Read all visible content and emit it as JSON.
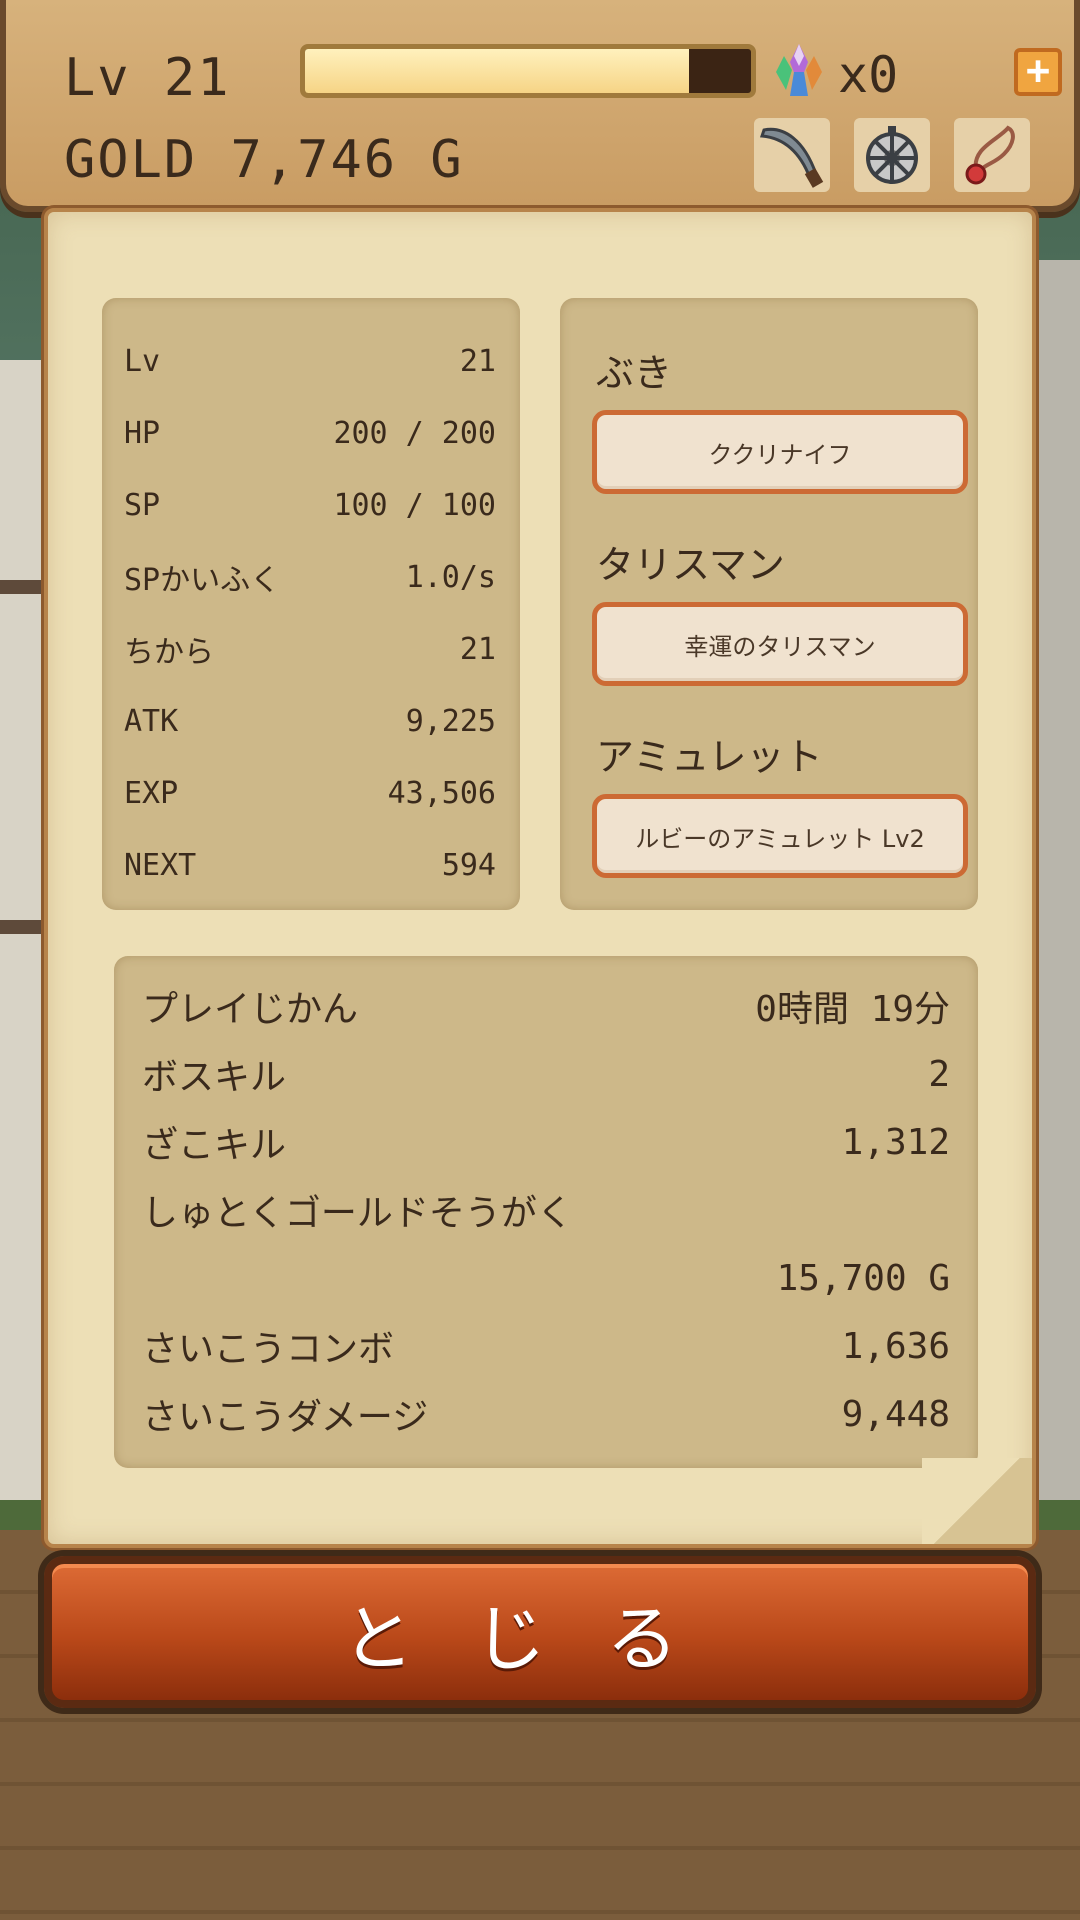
{
  "hud": {
    "level_text": "Lv 21",
    "gold_text": "GOLD 7,746 G",
    "exp_progress": 0.86,
    "gem_count": "x0",
    "plus_label": "+",
    "equipped_icons": [
      "kukri-knife-icon",
      "talisman-icon",
      "amulet-icon"
    ]
  },
  "stats": [
    {
      "label": "Lv",
      "value": "21"
    },
    {
      "label": "HP",
      "value": "200 / 200"
    },
    {
      "label": "SP",
      "value": "100 / 100"
    },
    {
      "label": "SPかいふく",
      "value": "1.0/s"
    },
    {
      "label": "ちから",
      "value": "21"
    },
    {
      "label": "ATK",
      "value": "9,225"
    },
    {
      "label": "EXP",
      "value": "43,506"
    },
    {
      "label": "NEXT",
      "value": "594"
    }
  ],
  "equipment": {
    "weapon_label": "ぶき",
    "weapon_name": "ククリナイフ",
    "talisman_label": "タリスマン",
    "talisman_name": "幸運のタリスマン",
    "amulet_label": "アミュレット",
    "amulet_name": "ルビーのアミュレット Lv2"
  },
  "records": {
    "playtime_label": "プレイじかん",
    "playtime_value": "0時間 19分",
    "boss_kill_label": "ボスキル",
    "boss_kill_value": "2",
    "mob_kill_label": "ざこキル",
    "mob_kill_value": "1,312",
    "total_gold_label": "しゅとくゴールドそうがく",
    "total_gold_value": "15,700 G",
    "max_combo_label": "さいこうコンボ",
    "max_combo_value": "1,636",
    "max_damage_label": "さいこうダメージ",
    "max_damage_value": "9,448"
  },
  "close_label": "とじる",
  "colors": {
    "accent_orange": "#cc6a34",
    "parchment": "#eddfb6",
    "panel": "#cdb889",
    "text_dark": "#3a2a1c"
  }
}
